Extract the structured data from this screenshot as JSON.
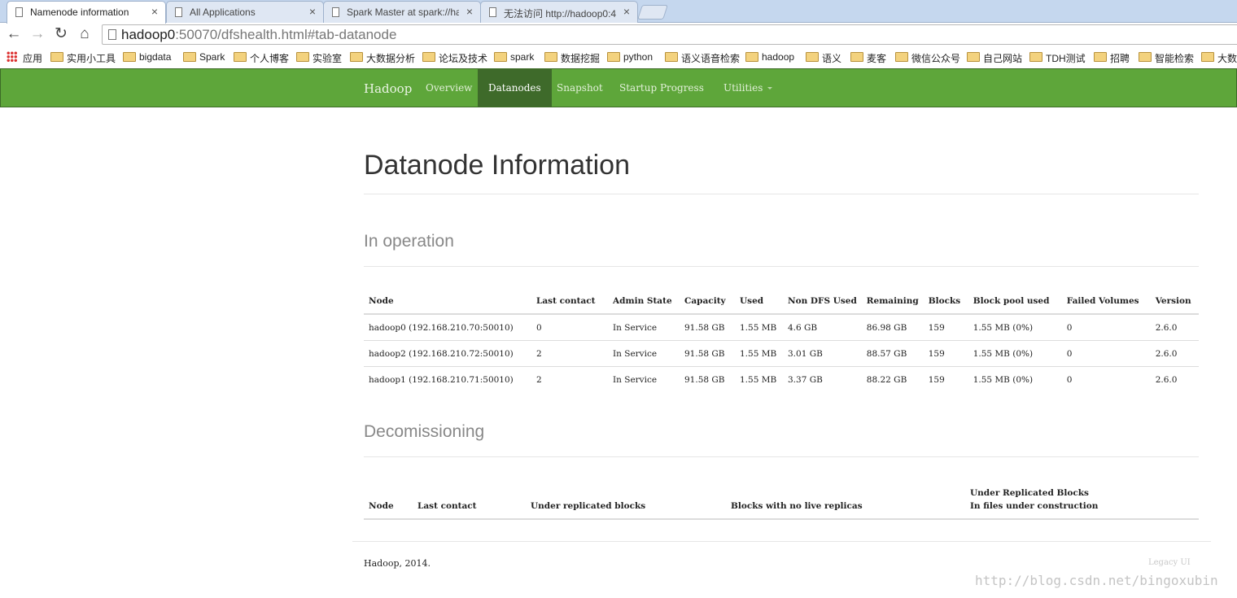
{
  "browser": {
    "tabs": [
      {
        "title": "Namenode information",
        "active": true
      },
      {
        "title": "All Applications",
        "active": false
      },
      {
        "title": "Spark Master at spark://ha",
        "active": false
      },
      {
        "title": "无法访问 http://hadoop0:4",
        "active": false
      }
    ],
    "close_glyph": "×",
    "url_host": "hadoop0",
    "url_rest": ":50070/dfshealth.html#tab-datanode",
    "nav": {
      "back": "←",
      "forward": "→",
      "reload": "↻",
      "home": "⌂"
    }
  },
  "bookmarks": [
    "应用",
    "实用小工具",
    "bigdata",
    "Spark",
    "个人博客",
    "实验室",
    "大数据分析",
    "论坛及技术",
    "spark",
    "数据挖掘",
    "python",
    "语义语音检索",
    "hadoop",
    "语义",
    "麦客",
    "微信公众号",
    "自己网站",
    "TDH测试",
    "招聘",
    "智能检索",
    "大数据"
  ],
  "navbar": {
    "brand": "Hadoop",
    "links": [
      "Overview",
      "Datanodes",
      "Snapshot",
      "Startup Progress",
      "Utilities"
    ],
    "active": "Datanodes",
    "accent": "#5ea63a"
  },
  "page": {
    "title": "Datanode Information",
    "in_operation": {
      "heading": "In operation",
      "columns": [
        "Node",
        "Last contact",
        "Admin State",
        "Capacity",
        "Used",
        "Non DFS Used",
        "Remaining",
        "Blocks",
        "Block pool used",
        "Failed Volumes",
        "Version"
      ],
      "rows": [
        [
          "hadoop0 (192.168.210.70:50010)",
          "0",
          "In Service",
          "91.58 GB",
          "1.55 MB",
          "4.6 GB",
          "86.98 GB",
          "159",
          "1.55 MB (0%)",
          "0",
          "2.6.0"
        ],
        [
          "hadoop2 (192.168.210.72:50010)",
          "2",
          "In Service",
          "91.58 GB",
          "1.55 MB",
          "3.01 GB",
          "88.57 GB",
          "159",
          "1.55 MB (0%)",
          "0",
          "2.6.0"
        ],
        [
          "hadoop1 (192.168.210.71:50010)",
          "2",
          "In Service",
          "91.58 GB",
          "1.55 MB",
          "3.37 GB",
          "88.22 GB",
          "159",
          "1.55 MB (0%)",
          "0",
          "2.6.0"
        ]
      ]
    },
    "decommissioning": {
      "heading": "Decomissioning",
      "columns": [
        "Node",
        "Last contact",
        "Under replicated blocks",
        "Blocks with no live replicas",
        "Under Replicated Blocks",
        "In files under construction"
      ]
    },
    "footer": {
      "left": "Hadoop, 2014.",
      "right": "Legacy UI"
    },
    "watermark": "http://blog.csdn.net/bingoxubin"
  }
}
